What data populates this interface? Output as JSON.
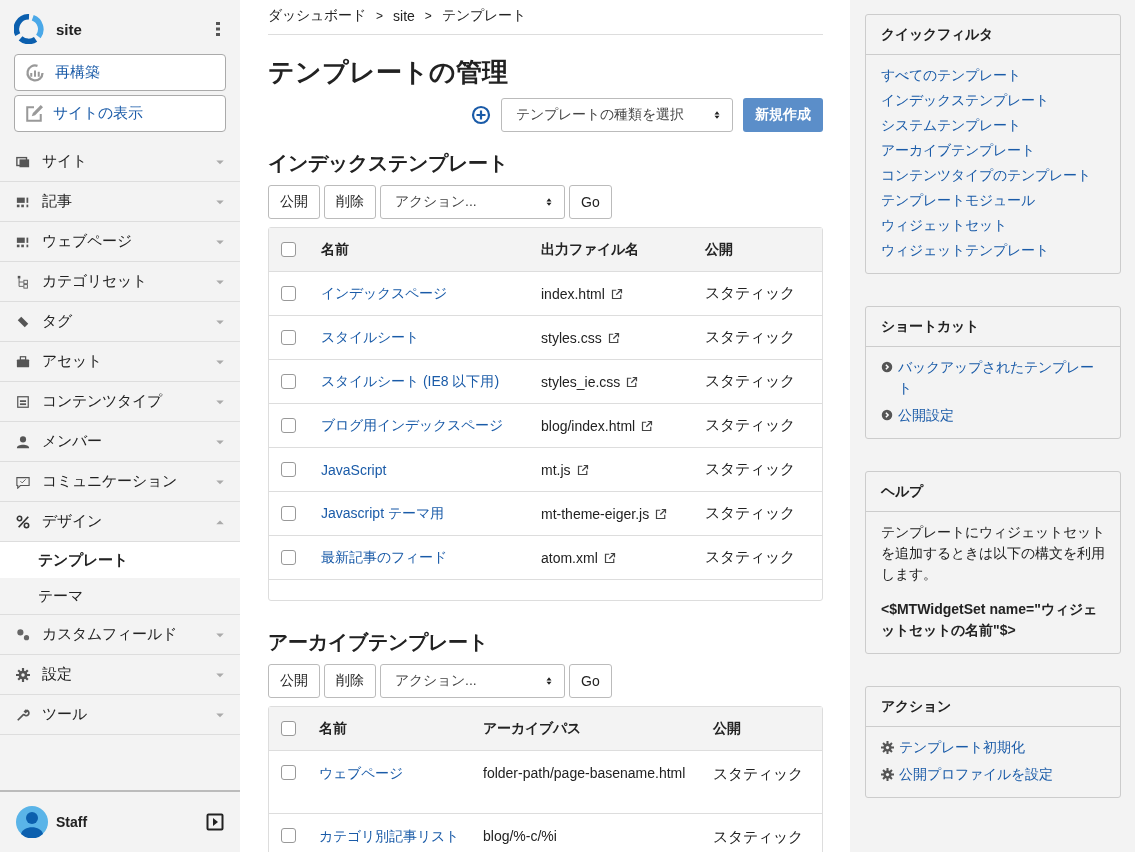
{
  "sidebar": {
    "site_name": "site",
    "buttons": [
      {
        "kind": "rebuild",
        "label": "再構築"
      },
      {
        "kind": "view",
        "label": "サイトの表示"
      }
    ],
    "nav": [
      {
        "label": "サイト",
        "expanded": false
      },
      {
        "label": "記事",
        "expanded": false
      },
      {
        "label": "ウェブページ",
        "expanded": false
      },
      {
        "label": "カテゴリセット",
        "expanded": false
      },
      {
        "label": "タグ",
        "expanded": false
      },
      {
        "label": "アセット",
        "expanded": false
      },
      {
        "label": "コンテンツタイプ",
        "expanded": false
      },
      {
        "label": "メンバー",
        "expanded": false
      },
      {
        "label": "コミュニケーション",
        "expanded": false
      },
      {
        "label": "デザイン",
        "expanded": true,
        "children": [
          {
            "label": "テンプレート",
            "selected": true
          },
          {
            "label": "テーマ",
            "selected": false
          }
        ]
      },
      {
        "label": "カスタムフィールド",
        "expanded": false
      },
      {
        "label": "設定",
        "expanded": false
      },
      {
        "label": "ツール",
        "expanded": false
      }
    ],
    "user": "Staff"
  },
  "breadcrumbs": [
    "ダッシュボード",
    "site",
    "テンプレート"
  ],
  "breadcrumb_separator": ">",
  "title": "テンプレートの管理",
  "create": {
    "select_placeholder": "テンプレートの種類を選択",
    "button": "新規作成"
  },
  "sections": [
    {
      "title": "インデックステンプレート",
      "actions": {
        "publish": "公開",
        "delete": "削除",
        "select": "アクション...",
        "go": "Go"
      },
      "columns": [
        "名前",
        "出力ファイル名",
        "公開"
      ],
      "all_checked": false,
      "tall_rows": false,
      "rows": [
        {
          "name": "インデックスページ",
          "path": "index.html",
          "external": true,
          "publish": "スタティック",
          "checked": false
        },
        {
          "name": "スタイルシート",
          "path": "styles.css",
          "external": true,
          "publish": "スタティック",
          "checked": false
        },
        {
          "name": "スタイルシート (IE8 以下用)",
          "path": "styles_ie.css",
          "external": true,
          "publish": "スタティック",
          "checked": false
        },
        {
          "name": "ブログ用インデックスページ",
          "path": "blog/index.html",
          "external": true,
          "publish": "スタティック",
          "checked": false
        },
        {
          "name": "JavaScript",
          "path": "mt.js",
          "external": true,
          "publish": "スタティック",
          "checked": false
        },
        {
          "name": "Javascript テーマ用",
          "path": "mt-theme-eiger.js",
          "external": true,
          "publish": "スタティック",
          "checked": false
        },
        {
          "name": "最新記事のフィード",
          "path": "atom.xml",
          "external": true,
          "publish": "スタティック",
          "checked": false
        }
      ]
    },
    {
      "title": "アーカイブテンプレート",
      "actions": {
        "publish": "公開",
        "delete": "削除",
        "select": "アクション...",
        "go": "Go"
      },
      "columns": [
        "名前",
        "アーカイブパス",
        "公開"
      ],
      "all_checked": false,
      "tall_rows": true,
      "rows": [
        {
          "name": "ウェブページ",
          "path": "folder-path/page-basename.html",
          "external": false,
          "publish": "スタティック",
          "checked": false
        },
        {
          "name": "カテゴリ別記事リスト",
          "path": "blog/%-c/%i",
          "external": false,
          "publish": "スタティック",
          "checked": false
        }
      ]
    }
  ],
  "widgets": [
    {
      "kind": "links",
      "title": "クイックフィルタ",
      "items": [
        "すべてのテンプレート",
        "インデックステンプレート",
        "システムテンプレート",
        "アーカイブテンプレート",
        "コンテンツタイプのテンプレート",
        "テンプレートモジュール",
        "ウィジェットセット",
        "ウィジェットテンプレート"
      ]
    },
    {
      "kind": "shortcuts",
      "title": "ショートカット",
      "items": [
        "バックアップされたテンプレート",
        "公開設定"
      ]
    },
    {
      "kind": "help",
      "title": "ヘルプ",
      "text": "テンプレートにウィジェットセットを追加するときは以下の構文を利用します。",
      "code": "<$MTWidgetSet name=\"ウィジェットセットの名前\"$>"
    },
    {
      "kind": "actions",
      "title": "アクション",
      "items": [
        "テンプレート初期化",
        "公開プロファイルを設定"
      ]
    }
  ]
}
